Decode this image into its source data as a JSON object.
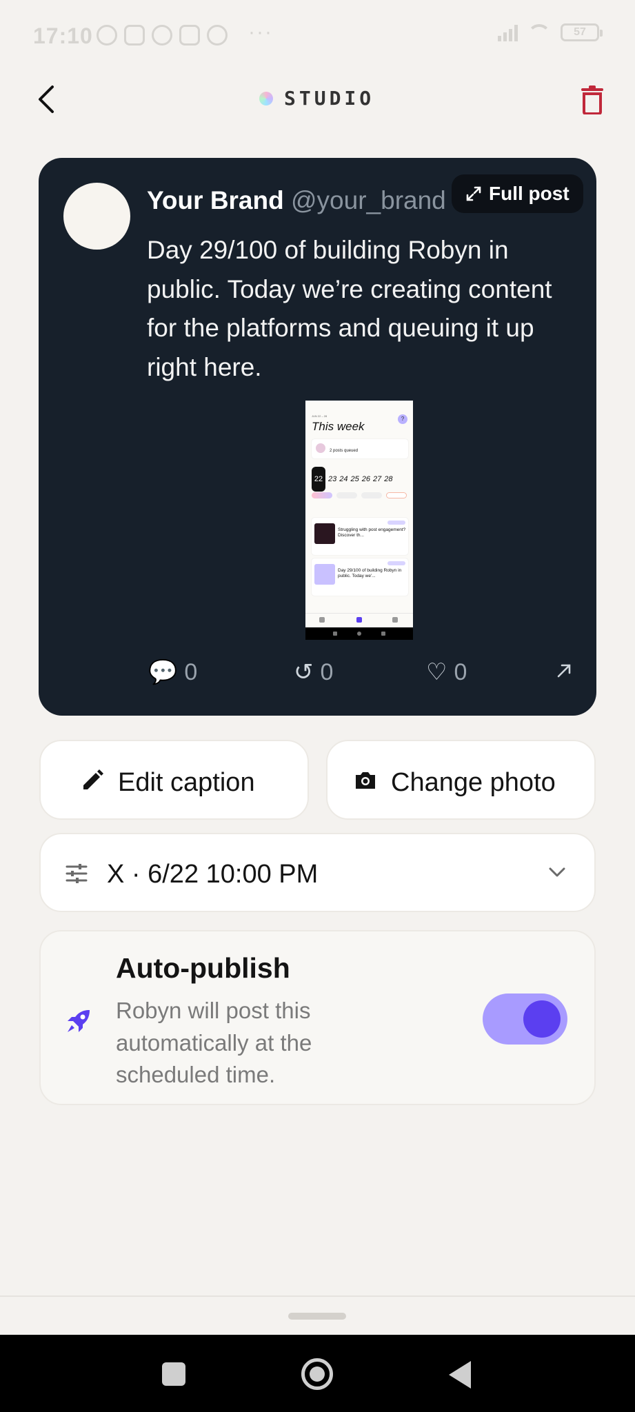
{
  "status_bar": {
    "time": "17:10",
    "more": "···",
    "battery": "57"
  },
  "header": {
    "brand": "STUDIO",
    "back_icon": "chevron-left-icon",
    "delete_icon": "trash-icon"
  },
  "post": {
    "name": "Your Brand",
    "handle": "@your_brand · now",
    "full_post_label": "Full post",
    "text": "Day 29/100 of building Robyn in public. Today we’re creating content for the platforms and queuing it up right here.",
    "stats": {
      "comments": "0",
      "reposts": "0",
      "likes": "0"
    }
  },
  "preview": {
    "range": "JUN 22 – 28",
    "title": "This week",
    "queue_text": "2 posts queued",
    "days": [
      "22",
      "23",
      "24",
      "25",
      "26",
      "27",
      "28"
    ],
    "rows": [
      "Struggling with post engagement? Discover th...",
      "Day 29/100 of building Robyn in public. Today we'..."
    ]
  },
  "actions": {
    "edit_caption": "Edit caption",
    "change_photo": "Change photo"
  },
  "schedule": {
    "label": "X · 6/22 10:00 PM"
  },
  "auto_publish": {
    "title": "Auto-publish",
    "description": "Robyn will post this automatically at the scheduled time.",
    "enabled": true
  },
  "colors": {
    "card_bg": "#17202b",
    "accent": "#5b3ff0",
    "accent_light": "#a89bff",
    "danger": "#c0283a",
    "page_bg": "#f4f2ef"
  }
}
